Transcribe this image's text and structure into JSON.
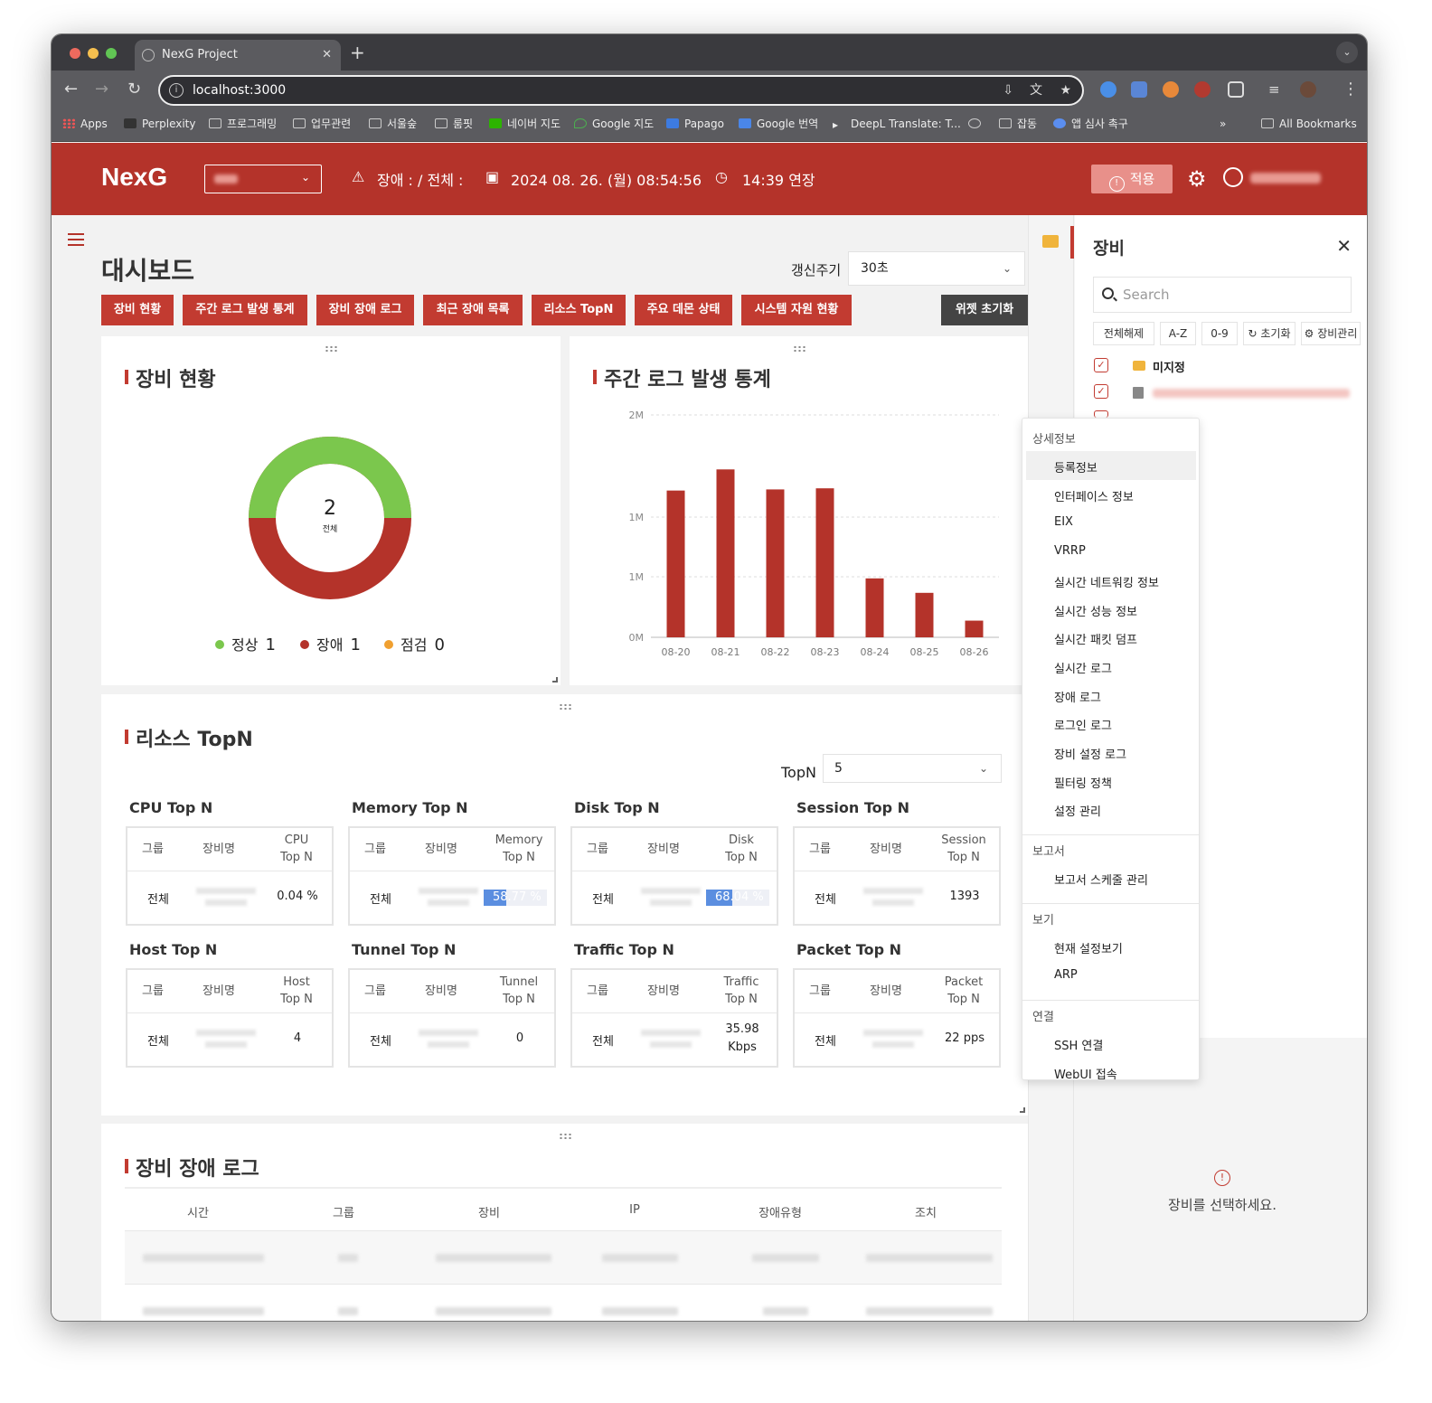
{
  "browser": {
    "tab_title": "NexG Project",
    "url": "localhost:3000",
    "bookmarks": [
      "Apps",
      "Perplexity",
      "프로그래밍",
      "업무관련",
      "서울숲",
      "룸핏",
      "네이버 지도",
      "Google 지도",
      "Papago",
      "Google 번역",
      "DeepL Translate: T...",
      "잡동",
      "앱 심사 촉구",
      "All Bookmarks"
    ]
  },
  "header": {
    "logo": "NexG",
    "alarm": "장애 : / 전체 :",
    "datetime": "2024 08. 26. (월) 08:54:56",
    "session": "14:39 연장",
    "apply": "적용"
  },
  "page": {
    "title": "대시보드",
    "refresh_label": "갱신주기",
    "refresh_value": "30초",
    "buttons": [
      "장비 현황",
      "주간 로그 발생 통계",
      "장비 장애 로그",
      "최근 장애 목록",
      "리소스 TopN",
      "주요 데몬 상태",
      "시스템 자원 현황"
    ],
    "reset": "위젯 초기화"
  },
  "device_status": {
    "title": "장비 현황",
    "total": "2",
    "total_label": "전체",
    "legend": [
      {
        "label": "정상",
        "value": "1",
        "color": "#7bc74d"
      },
      {
        "label": "장애",
        "value": "1",
        "color": "#b4332a"
      },
      {
        "label": "점검",
        "value": "0",
        "color": "#f0a030"
      }
    ]
  },
  "chart_data": {
    "type": "bar",
    "title": "주간 로그 발생 통계",
    "categories": [
      "08-20",
      "08-21",
      "08-22",
      "08-23",
      "08-24",
      "08-25",
      "08-26"
    ],
    "values": [
      1320000,
      1510000,
      1330000,
      1340000,
      530000,
      400000,
      150000
    ],
    "ytick_labels": [
      "2M",
      "1M",
      "1M",
      "0M"
    ],
    "ylim": [
      0,
      2000000
    ],
    "color": "#b4332a"
  },
  "topn": {
    "title": "리소스 TopN",
    "label": "TopN",
    "value": "5",
    "col_group": "그룹",
    "col_device": "장비명",
    "sections": [
      {
        "title": "CPU Top N",
        "metric": [
          "CPU",
          "Top N"
        ],
        "group": "전체",
        "value": "0.04 %"
      },
      {
        "title": "Memory Top N",
        "metric": [
          "Memory",
          "Top N"
        ],
        "group": "전체",
        "value": "58.77 %",
        "pct": 58.77
      },
      {
        "title": "Disk Top N",
        "metric": [
          "Disk",
          "Top N"
        ],
        "group": "전체",
        "value": "68.04 %",
        "pct": 68.04
      },
      {
        "title": "Session Top N",
        "metric": [
          "Session",
          "Top N"
        ],
        "group": "전체",
        "value": "1393"
      },
      {
        "title": "Host Top N",
        "metric": [
          "Host",
          "Top N"
        ],
        "group": "전체",
        "value": "4"
      },
      {
        "title": "Tunnel Top N",
        "metric": [
          "Tunnel",
          "Top N"
        ],
        "group": "전체",
        "value": "0"
      },
      {
        "title": "Traffic Top N",
        "metric": [
          "Traffic",
          "Top N"
        ],
        "group": "전체",
        "value": [
          "35.98",
          "Kbps"
        ]
      },
      {
        "title": "Packet Top N",
        "metric": [
          "Packet",
          "Top N"
        ],
        "group": "전체",
        "value": "22 pps"
      }
    ]
  },
  "fault_log": {
    "title": "장비 장애 로그",
    "columns": [
      "시간",
      "그룹",
      "장비",
      "IP",
      "장애유형",
      "조치"
    ]
  },
  "panel": {
    "title": "장비",
    "search_placeholder": "Search",
    "buttons": [
      "전체해제",
      "A-Z",
      "0-9",
      "초기화",
      "장비관리"
    ],
    "tree_first": "미지정",
    "empty_msg": "장비를 선택하세요."
  },
  "context_menu": {
    "sections": [
      {
        "title": "상세정보",
        "items": [
          "등록정보",
          "인터페이스 정보",
          "EIX",
          "VRRP",
          "실시간 네트워킹 정보",
          "실시간 성능 정보",
          "실시간 패킷 덤프",
          "실시간 로그",
          "장애 로그",
          "로그인 로그",
          "장비 설정 로그",
          "필터링 정책",
          "설정 관리"
        ]
      },
      {
        "title": "보고서",
        "items": [
          "보고서 스케줄 관리"
        ]
      },
      {
        "title": "보기",
        "items": [
          "현재 설정보기",
          "ARP"
        ]
      },
      {
        "title": "연결",
        "items": [
          "SSH 연결",
          "WebUI 접속"
        ]
      }
    ]
  }
}
